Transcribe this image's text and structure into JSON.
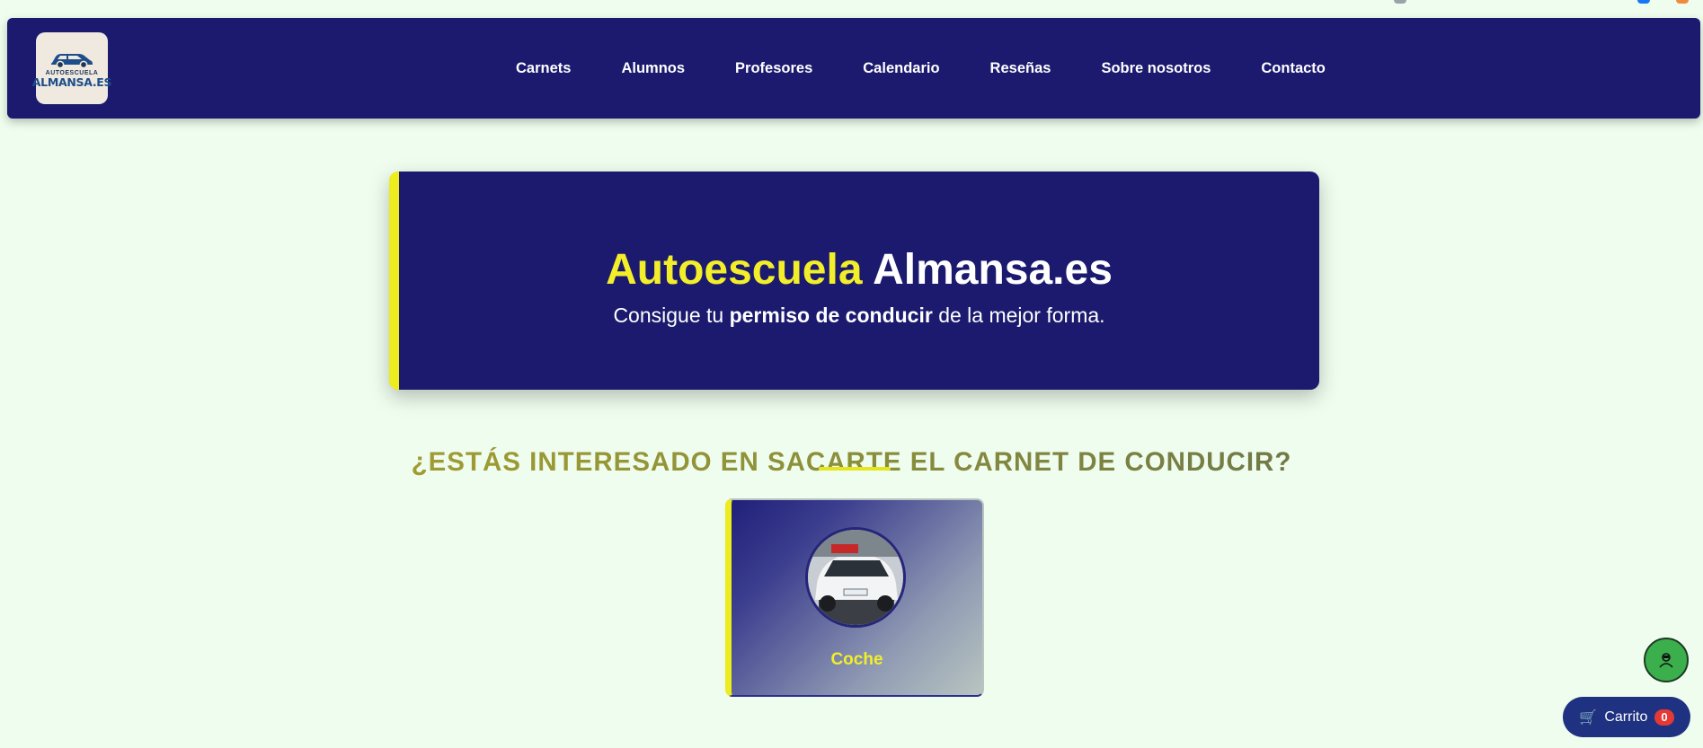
{
  "header": {
    "logo": {
      "line1": "AUTOESCUELA",
      "line2": "ALMANSA.ES"
    },
    "nav": [
      {
        "label": "Carnets"
      },
      {
        "label": "Alumnos"
      },
      {
        "label": "Profesores"
      },
      {
        "label": "Calendario"
      },
      {
        "label": "Reseñas"
      },
      {
        "label": "Sobre nosotros"
      },
      {
        "label": "Contacto"
      }
    ]
  },
  "hero": {
    "title_part1": "Autoescuela",
    "title_part2": "Almansa.es",
    "subtitle_pre": "Consigue tu",
    "subtitle_bold": "permiso de conducir",
    "subtitle_post": "de la mejor forma."
  },
  "section": {
    "title": "¿ESTÁS INTERESADO EN SACARTE EL CARNET DE CONDUCIR?"
  },
  "cards": [
    {
      "label": "Coche",
      "icon": "car-photo"
    }
  ],
  "floating": {
    "contact_icon": "user-icon",
    "cart_label": "Carrito",
    "cart_count": "0",
    "cart_icon": "cart-icon"
  },
  "colors": {
    "navy": "#1b1a6e",
    "accent_yellow": "#f2ee2a",
    "page_bg": "#effdef",
    "green_button": "#3caf4d",
    "badge_red": "#e53935"
  }
}
